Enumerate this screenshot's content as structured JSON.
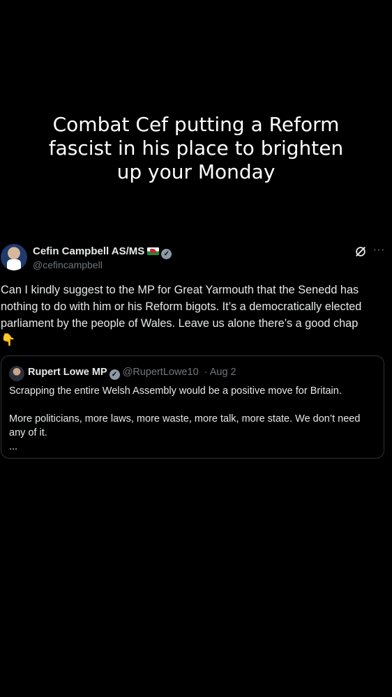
{
  "caption": {
    "lines": [
      "Combat Cef putting a Reform",
      "fascist in his place to brighten",
      "up your Monday"
    ]
  },
  "tweet": {
    "author_name": "Cefin Campbell AS/MS",
    "handle": "@cefincampbell",
    "more_label": "···",
    "body_lines": [
      "Can I kindly suggest to the MP for Great Yarmouth that the Senedd has",
      "nothing to do with him or his Reform bigots. It’s a democratically elected",
      "parliament by the people of Wales. Leave us alone there’s a good chap"
    ],
    "emoji": "👇",
    "icons": {
      "grok": "grok-icon",
      "more": "more-icon",
      "verified": "verified-badge-icon",
      "flag": "wales-flag-icon"
    }
  },
  "quote": {
    "author_name": "Rupert Lowe MP",
    "handle": "@RupertLowe10",
    "date": "· Aug 2",
    "line1": "Scrapping the entire Welsh Assembly would be a positive move for Britain.",
    "line2": "More politicians, more laws, more waste, more talk, more state. We don’t need",
    "line3": "any of it.",
    "ellipsis": "..."
  },
  "colors": {
    "background": "#000000",
    "text": "#e7e9ea",
    "secondary": "#71767b",
    "border": "#2f3336"
  }
}
